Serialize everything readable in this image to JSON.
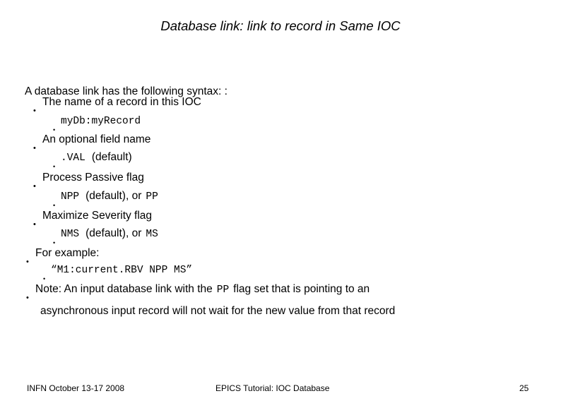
{
  "slide": {
    "title": "Database link: link to record in Same IOC",
    "lead": "A database link has the following syntax: :",
    "items": [
      {
        "label": "The name of a record in this IOC",
        "code_line": "myDb:myRecord"
      },
      {
        "label": "An optional field name",
        "code": ".VAL",
        "code_suffix": "(default)"
      },
      {
        "label": "Process Passive flag",
        "code": "NPP",
        "code_mid": "(default), or",
        "code_tail": "PP"
      },
      {
        "label": "Maximize Severity flag",
        "code": "NMS",
        "code_mid": "(default), or",
        "code_tail": "MS"
      }
    ],
    "example": {
      "label": "For example:",
      "value": "“M1:current.RBV NPP MS”"
    },
    "note": {
      "prefix": "Note: An input database link with the",
      "flag": "PP",
      "suffix": "flag set that is pointing to an",
      "line2": "asynchronous input record will not wait for the new value from that record"
    }
  },
  "footer": {
    "left": "INFN October 13-17 2008",
    "center": "EPICS Tutorial: IOC Database",
    "page": "25"
  }
}
